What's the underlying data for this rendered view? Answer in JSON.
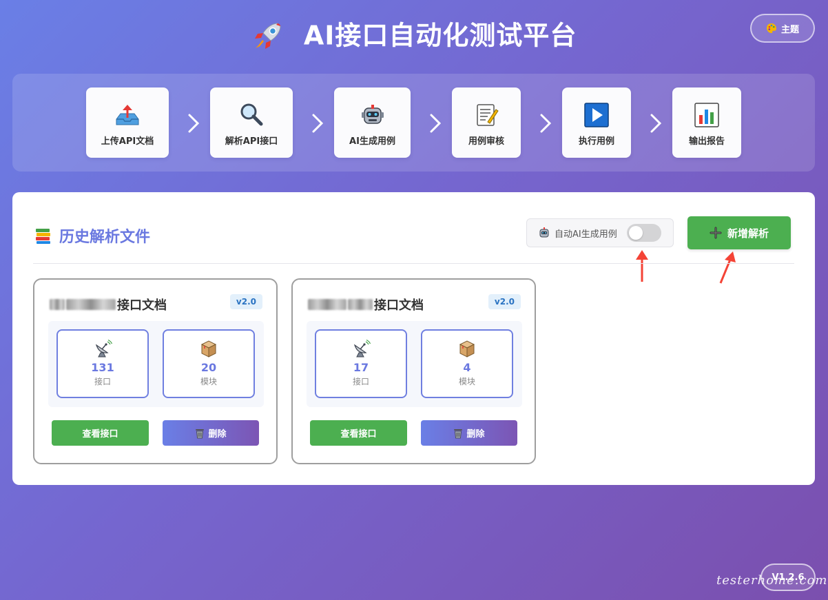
{
  "app": {
    "title": "AI接口自动化测试平台"
  },
  "header": {
    "theme_label": "主题"
  },
  "workflow": {
    "steps": [
      {
        "label": "上传API文档",
        "icon": "upload-tray-icon"
      },
      {
        "label": "解析API接口",
        "icon": "magnifier-icon"
      },
      {
        "label": "AI生成用例",
        "icon": "robot-icon"
      },
      {
        "label": "用例审核",
        "icon": "memo-icon"
      },
      {
        "label": "执行用例",
        "icon": "play-icon"
      },
      {
        "label": "输出报告",
        "icon": "bar-chart-icon"
      }
    ]
  },
  "history": {
    "title": "历史解析文件",
    "auto_ai_label": "自动AI生成用例",
    "auto_ai_enabled": false,
    "add_label": "新增解析",
    "cards": [
      {
        "title_suffix": "接口文档",
        "version": "v2.0",
        "interfaces_value": "131",
        "interfaces_label": "接口",
        "modules_value": "20",
        "modules_label": "模块",
        "view_label": "查看接口",
        "delete_label": "删除"
      },
      {
        "title_suffix": "接口文档",
        "version": "v2.0",
        "interfaces_value": "17",
        "interfaces_label": "接口",
        "modules_value": "4",
        "modules_label": "模块",
        "view_label": "查看接口",
        "delete_label": "删除"
      }
    ]
  },
  "footer": {
    "version": "V1.2.6",
    "watermark": "testerhome.com"
  },
  "colors": {
    "accent": "#6a78e0",
    "green": "#4caf50",
    "annotation": "#f44336"
  }
}
